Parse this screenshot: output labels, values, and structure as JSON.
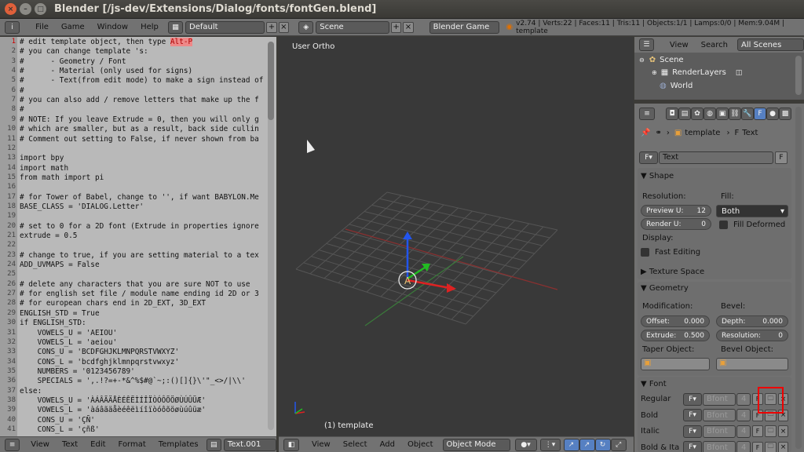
{
  "window": {
    "title": "Blender [/js-dev/Extensions/Dialog/fonts/fontGen.blend]"
  },
  "topbar": {
    "menus": [
      "File",
      "Game",
      "Window",
      "Help"
    ],
    "layout": "Default",
    "scene": "Scene",
    "engine": "Blender Game",
    "status": "v2.74 | Verts:22 | Faces:11 | Tris:11 | Objects:1/1 | Lamps:0/0 | Mem:9.04M | template"
  },
  "editor": {
    "lines": [
      {
        "n": "1",
        "t": "# edit template object, then type ",
        "hl": "Alt-P"
      },
      {
        "n": "2",
        "t": "# you can change template 's:"
      },
      {
        "n": "3",
        "t": "#      - Geometry / Font"
      },
      {
        "n": "4",
        "t": "#      - Material (only used for signs)"
      },
      {
        "n": "5",
        "t": "#      - Text(from edit mode) to make a sign instead of"
      },
      {
        "n": "6",
        "t": "#"
      },
      {
        "n": "7",
        "t": "# you can also add / remove letters that make up the f"
      },
      {
        "n": "8",
        "t": "#"
      },
      {
        "n": "9",
        "t": "# NOTE: If you leave Extrude = 0, then you will only g"
      },
      {
        "n": "10",
        "t": "# which are smaller, but as a result, back side cullin"
      },
      {
        "n": "11",
        "t": "# Comment out setting to False, if never shown from ba"
      },
      {
        "n": "12",
        "t": ""
      },
      {
        "n": "13",
        "t": "import bpy"
      },
      {
        "n": "14",
        "t": "import math"
      },
      {
        "n": "15",
        "t": "from math import pi"
      },
      {
        "n": "16",
        "t": ""
      },
      {
        "n": "17",
        "t": "# for Tower of Babel, change to '', if want BABYLON.Me"
      },
      {
        "n": "18",
        "t": "BASE_CLASS = 'DIALOG.Letter'"
      },
      {
        "n": "19",
        "t": ""
      },
      {
        "n": "20",
        "t": "# set to 0 for a 2D font (Extrude in properties ignore"
      },
      {
        "n": "21",
        "t": "extrude = 0.5"
      },
      {
        "n": "22",
        "t": ""
      },
      {
        "n": "23",
        "t": "# change to true, if you are setting material to a tex"
      },
      {
        "n": "24",
        "t": "ADD_UVMAPS = False"
      },
      {
        "n": "25",
        "t": ""
      },
      {
        "n": "26",
        "t": "# delete any characters that you are sure NOT to use"
      },
      {
        "n": "27",
        "t": "# for english set file / module name ending id 2D or 3"
      },
      {
        "n": "28",
        "t": "# for european chars end in 2D_EXT, 3D_EXT"
      },
      {
        "n": "29",
        "t": "ENGLISH_STD = True"
      },
      {
        "n": "30",
        "t": "if ENGLISH_STD:"
      },
      {
        "n": "31",
        "t": "    VOWELS_U = 'AEIOU'"
      },
      {
        "n": "32",
        "t": "    VOWELS_L = 'aeiou'"
      },
      {
        "n": "33",
        "t": "    CONS_U = 'BCDFGHJKLMNPQRSTVWXYZ'"
      },
      {
        "n": "34",
        "t": "    CONS_L = 'bcdfghjklmnpqrstvwxyz'"
      },
      {
        "n": "35",
        "t": "    NUMBERS = '0123456789'"
      },
      {
        "n": "36",
        "t": "    SPECIALS = ',.!?=+-*&^%$#@`~;:()[]{}\\'\"_<>/|\\\\'"
      },
      {
        "n": "37",
        "t": "else:"
      },
      {
        "n": "38",
        "t": "    VOWELS_U = 'ÀÁÂÃÄÅÈÉÊËÌÍÎÏÒÓÔÕÖØÙÚÛÜÆ'"
      },
      {
        "n": "39",
        "t": "    VOWELS_L = 'àáâãäåèéêëìíîïòóôõöøùúûüæ'"
      },
      {
        "n": "40",
        "t": "    CONS_U = 'ÇÑ'"
      },
      {
        "n": "41",
        "t": "    CONS_L = 'çñß'"
      }
    ],
    "footer": {
      "menus": [
        "View",
        "Text",
        "Edit",
        "Format",
        "Templates"
      ],
      "file": "Text.001"
    }
  },
  "viewport": {
    "label": "User Ortho",
    "object_label": "(1) template",
    "footer": {
      "menus": [
        "View",
        "Select",
        "Add",
        "Object"
      ],
      "mode": "Object Mode"
    }
  },
  "outliner": {
    "menus": [
      "View",
      "Search"
    ],
    "filter": "All Scenes",
    "items": [
      "Scene",
      "RenderLayers",
      "World"
    ]
  },
  "properties": {
    "breadcrumb": [
      "template",
      "Text"
    ],
    "datablock": "Text",
    "datablock_btn": "F",
    "shape": {
      "header": "Shape",
      "resolution_label": "Resolution:",
      "fill_label": "Fill:",
      "preview_label": "Preview U:",
      "preview_value": "12",
      "render_label": "Render U:",
      "render_value": "0",
      "fill_value": "Both",
      "fill_deformed": "Fill Deformed",
      "display_label": "Display:",
      "fast_editing": "Fast Editing"
    },
    "texture_space": "Texture Space",
    "geometry": {
      "header": "Geometry",
      "modification": "Modification:",
      "bevel": "Bevel:",
      "offset_label": "Offset:",
      "offset": "0.000",
      "depth_label": "Depth:",
      "depth": "0.000",
      "extrude_label": "Extrude:",
      "extrude": "0.500",
      "resolution_label": "Resolution:",
      "resolution": "0",
      "taper": "Taper Object:",
      "bevel_obj": "Bevel Object:"
    },
    "font": {
      "header": "Font",
      "rows": [
        {
          "label": "Regular",
          "font": "Bfont",
          "users": "4"
        },
        {
          "label": "Bold",
          "font": "Bfont",
          "users": "4"
        },
        {
          "label": "Italic",
          "font": "Bfont",
          "users": "4"
        },
        {
          "label": "Bold & Ita",
          "font": "Bfont",
          "users": "4"
        }
      ]
    }
  },
  "colors": {
    "accent": "#5680c2",
    "highlight_box": "#e00000",
    "viewport_bg": "#393939"
  }
}
